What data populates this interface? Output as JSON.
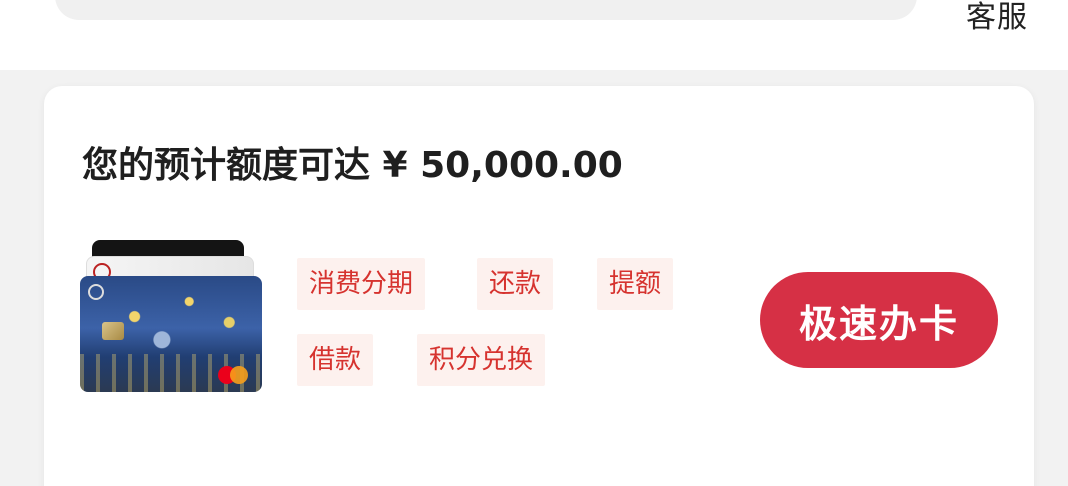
{
  "header": {
    "service_label": "客服"
  },
  "panel": {
    "quota_title": "您的预计额度可达 ¥ 50,000.00",
    "tags": [
      {
        "label": "消费分期"
      },
      {
        "label": "还款"
      },
      {
        "label": "提额"
      },
      {
        "label": "借款"
      },
      {
        "label": "积分兑换"
      }
    ],
    "apply_button": "极速办卡"
  },
  "colors": {
    "accent": "#d63045",
    "tag_text": "#d6332f",
    "tag_bg": "#fdf1ee"
  }
}
